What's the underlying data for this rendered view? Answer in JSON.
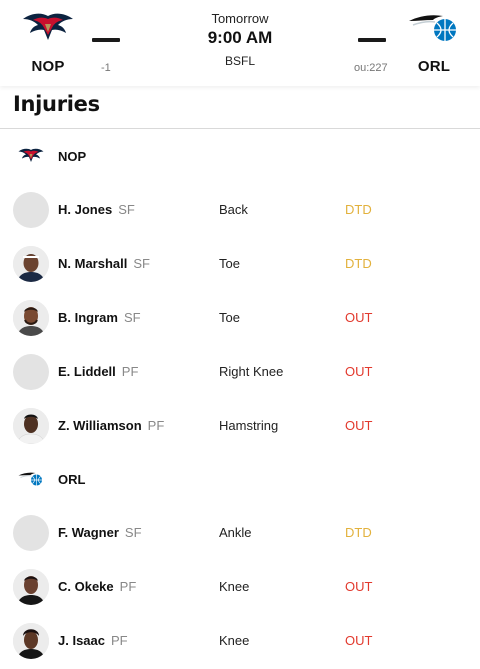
{
  "game": {
    "home": {
      "abbr": "NOP",
      "logo_icon": "pelicans-logo-icon",
      "odds": "-1"
    },
    "away": {
      "abbr": "ORL",
      "logo_icon": "magic-logo-icon",
      "odds": "ou:227"
    },
    "day": "Tomorrow",
    "time": "9:00 AM",
    "network": "BSFL"
  },
  "injuries": {
    "title": "Injuries",
    "teams": [
      {
        "name": "NOP",
        "icon": "pelicans-logo-icon",
        "players": [
          {
            "name": "H. Jones",
            "pos": "SF",
            "injury": "Back",
            "status": "DTD",
            "photo": false
          },
          {
            "name": "N. Marshall",
            "pos": "SF",
            "injury": "Toe",
            "status": "DTD",
            "photo": true
          },
          {
            "name": "B. Ingram",
            "pos": "SF",
            "injury": "Toe",
            "status": "OUT",
            "photo": true
          },
          {
            "name": "E. Liddell",
            "pos": "PF",
            "injury": "Right Knee",
            "status": "OUT",
            "photo": false
          },
          {
            "name": "Z. Williamson",
            "pos": "PF",
            "injury": "Hamstring",
            "status": "OUT",
            "photo": true
          }
        ]
      },
      {
        "name": "ORL",
        "icon": "magic-logo-icon",
        "players": [
          {
            "name": "F. Wagner",
            "pos": "SF",
            "injury": "Ankle",
            "status": "DTD",
            "photo": false
          },
          {
            "name": "C. Okeke",
            "pos": "PF",
            "injury": "Knee",
            "status": "OUT",
            "photo": true
          },
          {
            "name": "J. Isaac",
            "pos": "PF",
            "injury": "Knee",
            "status": "OUT",
            "photo": true
          }
        ]
      }
    ]
  },
  "colors": {
    "dtd": "#e2b13c",
    "out": "#e2392d"
  }
}
